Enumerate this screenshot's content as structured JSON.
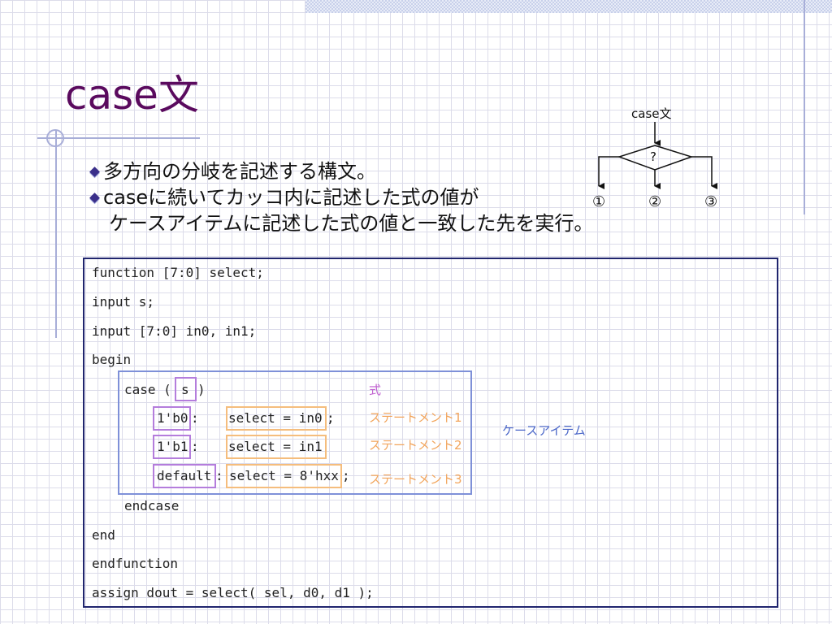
{
  "title": "case文",
  "bullets": [
    "多方向の分岐を記述する構文。",
    "caseに続いてカッコ内に記述した式の値が",
    "ケースアイテムに記述した式の値と一致した先を実行。"
  ],
  "flowchart": {
    "label": "case文",
    "condition": "?",
    "branches": [
      "①",
      "②",
      "③"
    ]
  },
  "code": {
    "line1": "function [7:0] select;",
    "line2": "input s;",
    "line3": "input [7:0] in0, in1;",
    "line4": "begin",
    "case_kw": "case (",
    "case_expr": "s",
    "case_close": ")",
    "item1_value": "1'b0",
    "item1_colon": ":",
    "item1_stmt": "select = in0",
    "item1_semi": ";",
    "item2_value": "1'b1",
    "item2_colon": ":",
    "item2_stmt": "select = in1",
    "item3_value": "default",
    "item3_colon": ":",
    "item3_stmt": "select = 8'hxx",
    "item3_semi": ";",
    "endcase": "endcase",
    "end": "end",
    "endfunction": "endfunction",
    "assign": "assign dout = select( sel, d0, d1 );"
  },
  "annotations": {
    "expr": "式",
    "stmt1": "ステートメント1",
    "stmt2": "ステートメント2",
    "stmt3": "ステートメント3",
    "case_items": "ケースアイテム"
  },
  "colors": {
    "title": "#5a0a5e",
    "code_border": "#20256e",
    "case_items": "#7e90d8",
    "expression": "#b47ddc",
    "statement": "#f5bd7d"
  }
}
